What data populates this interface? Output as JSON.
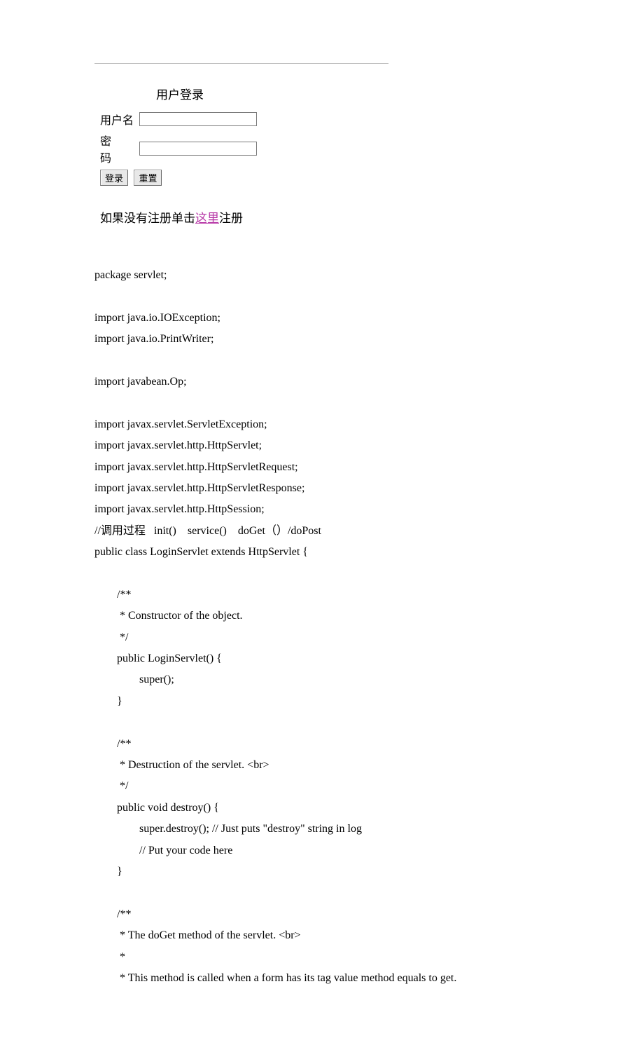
{
  "login": {
    "title": "用户登录",
    "username_label": "用户名",
    "password_label": "密 码",
    "username_value": "",
    "password_value": "",
    "login_btn": "登录",
    "reset_btn": "重置",
    "register_prefix": "如果没有注册单击",
    "register_link": "这里",
    "register_suffix": "注册"
  },
  "code": {
    "l01": "package servlet;",
    "l02": "",
    "l03": "import java.io.IOException;",
    "l04": "import java.io.PrintWriter;",
    "l05": "",
    "l06": "import javabean.Op;",
    "l07": "",
    "l08": "import javax.servlet.ServletException;",
    "l09": "import javax.servlet.http.HttpServlet;",
    "l10": "import javax.servlet.http.HttpServletRequest;",
    "l11": "import javax.servlet.http.HttpServletResponse;",
    "l12": "import javax.servlet.http.HttpSession;",
    "l13": "//调用过程   init()    service()    doGet（）/doPost",
    "l14": "public class LoginServlet extends HttpServlet {",
    "l15": "",
    "l16": "        /**",
    "l17": "         * Constructor of the object.",
    "l18": "         */",
    "l19": "        public LoginServlet() {",
    "l20": "                super();",
    "l21": "        }",
    "l22": "",
    "l23": "        /**",
    "l24": "         * Destruction of the servlet. <br>",
    "l25": "         */",
    "l26": "        public void destroy() {",
    "l27": "                super.destroy(); // Just puts \"destroy\" string in log",
    "l28": "                // Put your code here",
    "l29": "        }",
    "l30": "",
    "l31": "        /**",
    "l32": "         * The doGet method of the servlet. <br>",
    "l33": "         *",
    "l34": "         * This method is called when a form has its tag value method equals to get."
  }
}
